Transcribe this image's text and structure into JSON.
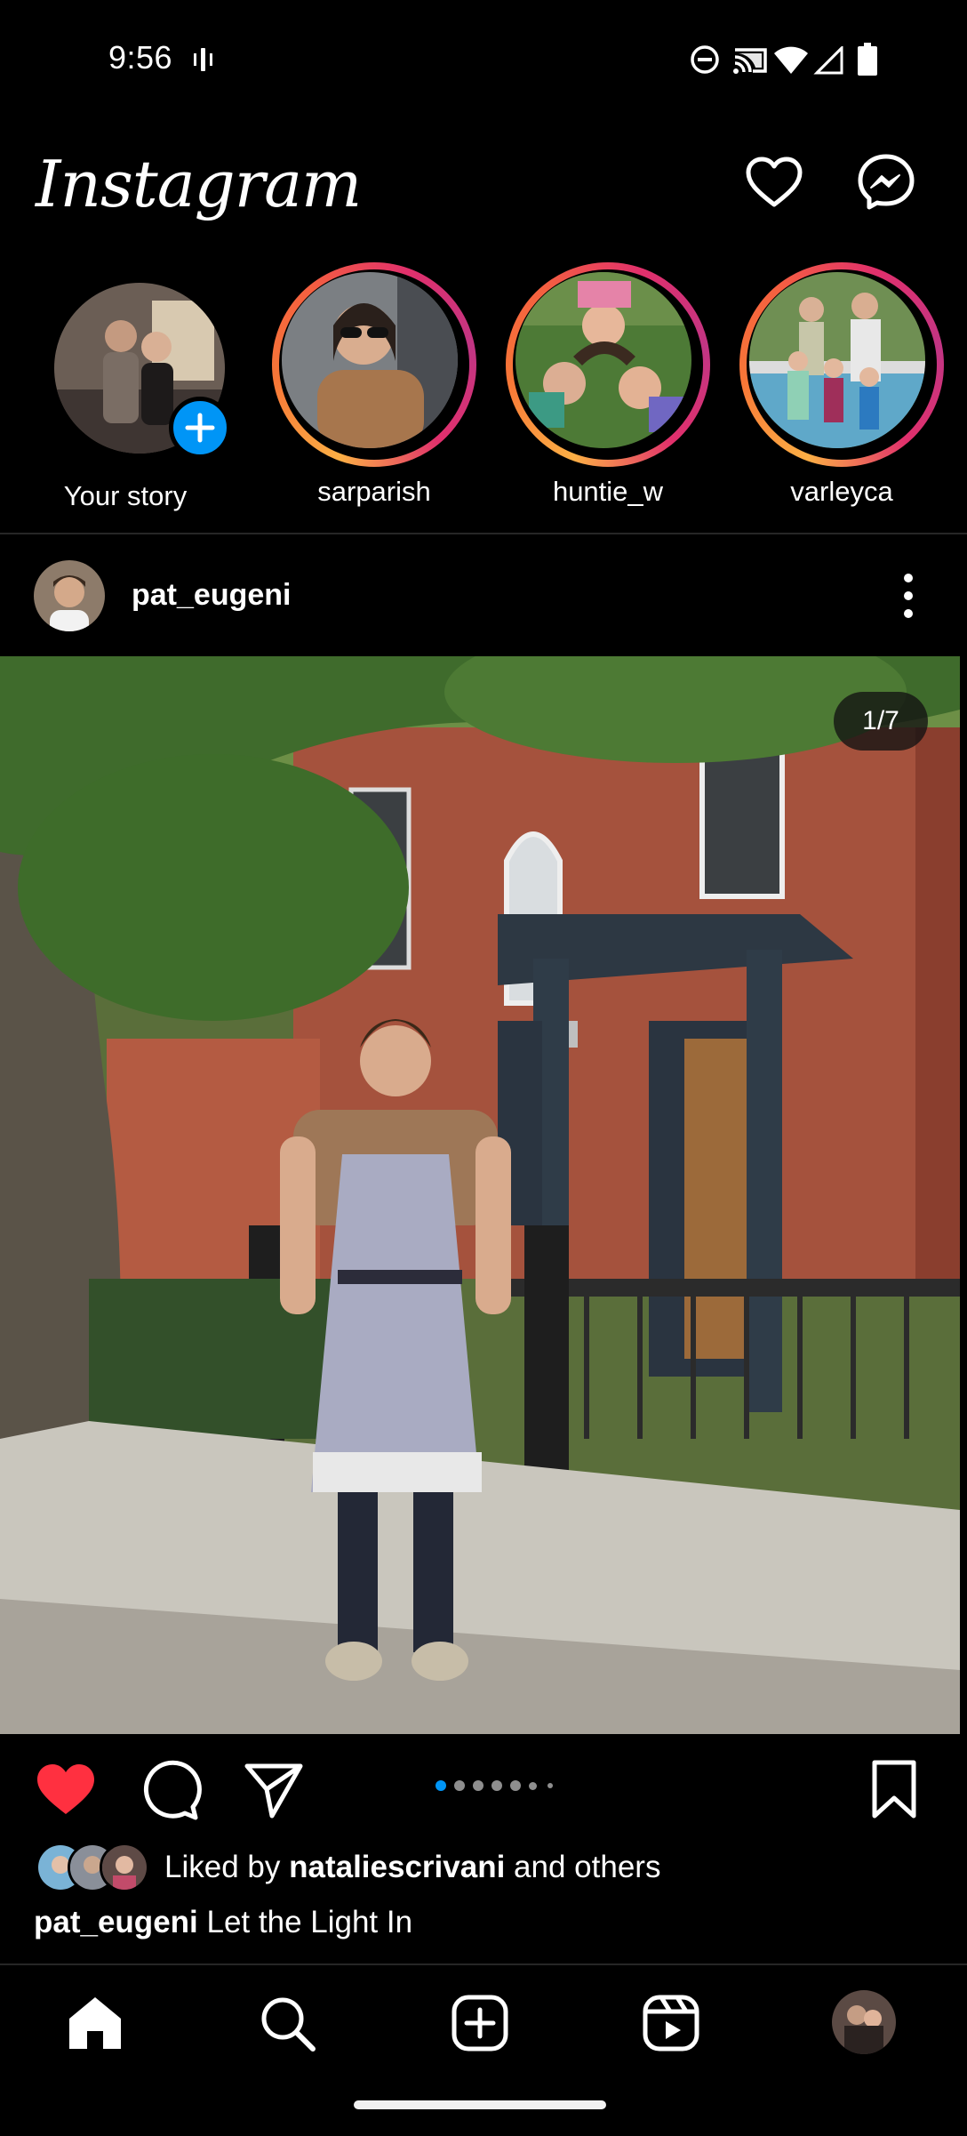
{
  "status_bar": {
    "time": "9:56",
    "icons": [
      "vibrate-icon",
      "do-not-disturb-icon",
      "cast-icon",
      "wifi-icon",
      "signal-icon",
      "battery-icon"
    ]
  },
  "header": {
    "logo": "Instagram",
    "icons": [
      "heart-icon",
      "messenger-icon"
    ]
  },
  "stories": [
    {
      "label": "Your story",
      "own": true
    },
    {
      "label": "sarparish"
    },
    {
      "label": "huntie_w"
    },
    {
      "label": "varleyca"
    }
  ],
  "post": {
    "username": "pat_eugeni",
    "image_counter": "1/7",
    "image_count": 7,
    "current_image": 1,
    "liked": true,
    "likes": {
      "prefix": "Liked by",
      "user": "nataliescrivani",
      "suffix": "and others"
    },
    "caption": {
      "username": "pat_eugeni",
      "text": "Let the Light In"
    }
  },
  "bottom_nav": {
    "items": [
      "home-icon",
      "search-icon",
      "new-post-icon",
      "reels-icon",
      "profile-avatar"
    ],
    "active": "home-icon"
  },
  "colors": {
    "background": "#000000",
    "accent_blue": "#0095f6",
    "like_red": "#ff3040"
  }
}
